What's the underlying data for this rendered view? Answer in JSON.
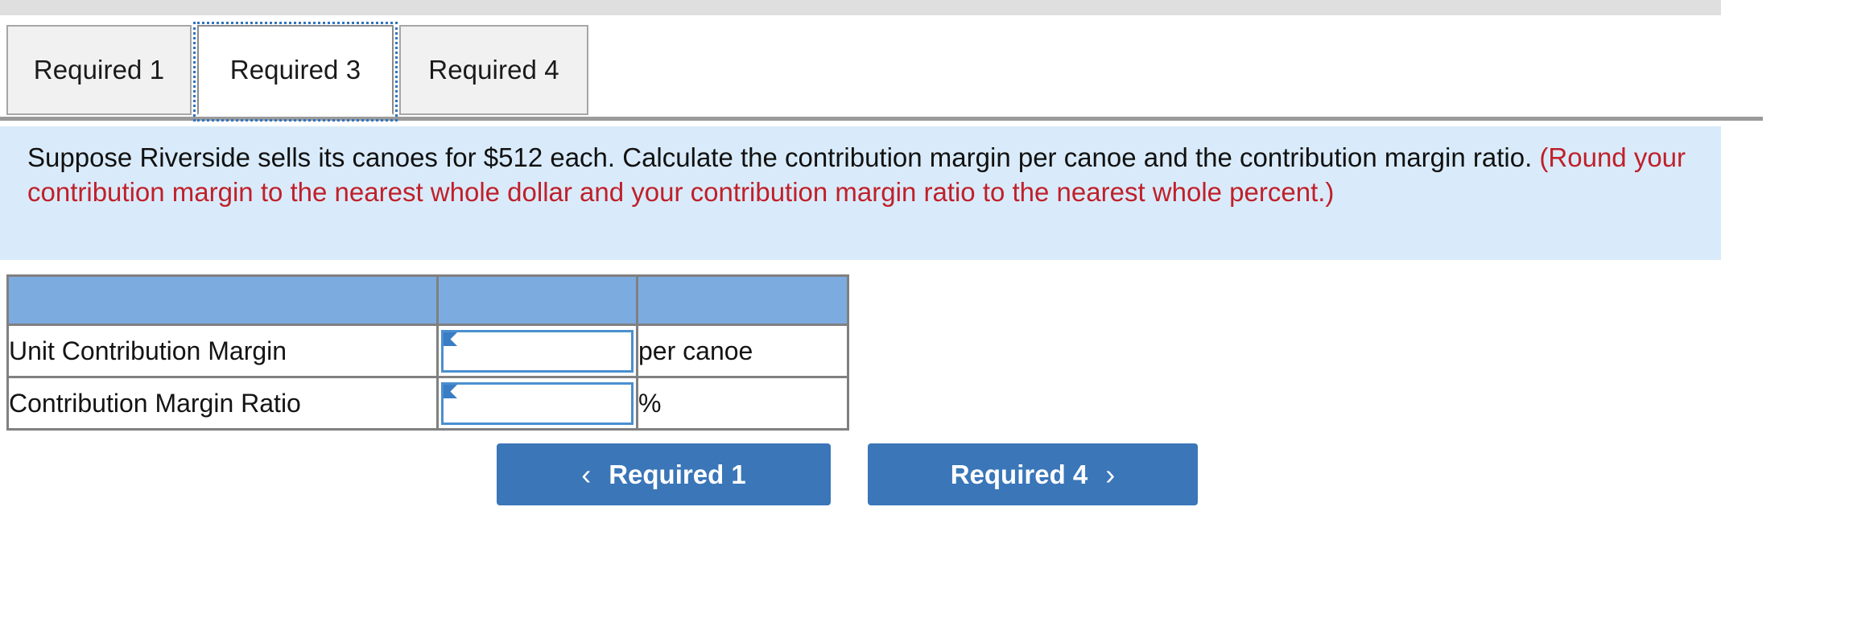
{
  "tabs": [
    {
      "label": "Required 1",
      "active": false
    },
    {
      "label": "Required 3",
      "active": true
    },
    {
      "label": "Required 4",
      "active": false
    }
  ],
  "instructions": {
    "main_text": "Suppose Riverside sells its canoes for $512 each. Calculate the contribution margin per canoe and the contribution margin ratio.",
    "note_text": "(Round your contribution margin to the nearest whole dollar and your contribution margin ratio to the nearest whole percent.)",
    "note_color": "#c0202a",
    "panel_color": "#d9ebfa"
  },
  "answer_table": {
    "header": {
      "col1": "",
      "col2": "",
      "col3": ""
    },
    "header_color": "#7cabe0",
    "rows": [
      {
        "label": "Unit Contribution Margin",
        "value": "",
        "placeholder": "",
        "unit": "per canoe"
      },
      {
        "label": "Contribution Margin Ratio",
        "value": "",
        "placeholder": "",
        "unit": "%"
      }
    ]
  },
  "navigation": {
    "prev": {
      "label": "Required 1",
      "icon": "chevron-left-icon",
      "glyph": "‹"
    },
    "next": {
      "label": "Required 4",
      "icon": "chevron-right-icon",
      "glyph": "›"
    },
    "button_color": "#3a76b8"
  }
}
